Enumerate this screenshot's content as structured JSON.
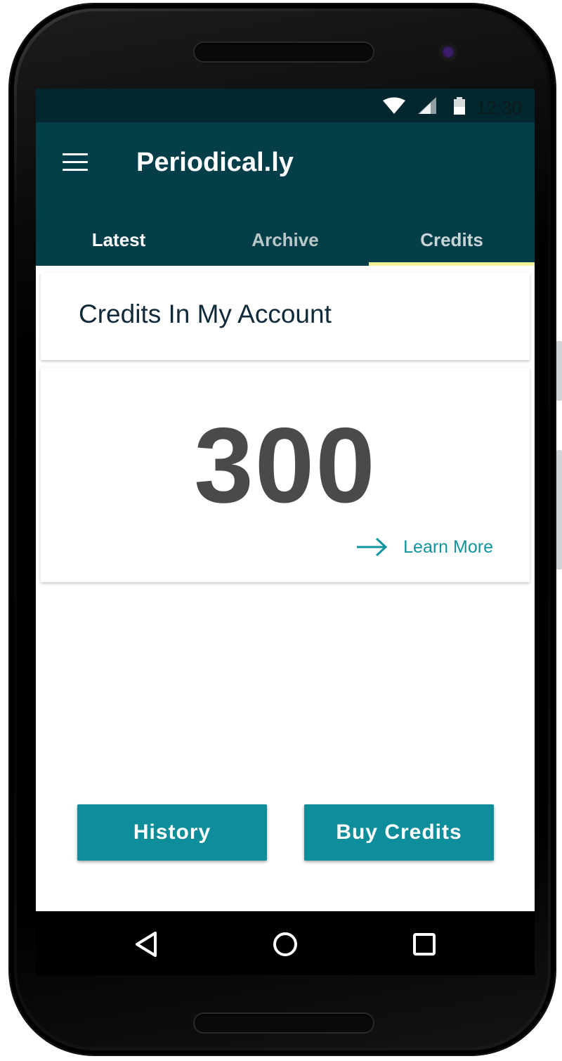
{
  "status_bar": {
    "time": "12:30",
    "icons": [
      "wifi-icon",
      "signal-icon",
      "battery-icon"
    ]
  },
  "app_bar": {
    "menu_icon": "hamburger-menu-icon",
    "title": "Periodical.ly"
  },
  "tabs": [
    {
      "label": "Latest"
    },
    {
      "label": "Archive"
    },
    {
      "label": "Credits",
      "selected": true
    }
  ],
  "credits_card": {
    "title": "Credits In My Account"
  },
  "balance_card": {
    "amount": "300",
    "link_icon": "arrow-right-icon",
    "link_label": "Learn More"
  },
  "actions": {
    "history_label": "History",
    "buy_label": "Buy Credits"
  },
  "nav_bar": {
    "icons": [
      "back-icon",
      "home-icon",
      "recents-icon"
    ]
  },
  "colors": {
    "app_bar": "#043f49",
    "status_bar": "#03272e",
    "accent": "#0e8e9a",
    "tab_indicator": "#f4f29b",
    "link": "#10959f"
  }
}
